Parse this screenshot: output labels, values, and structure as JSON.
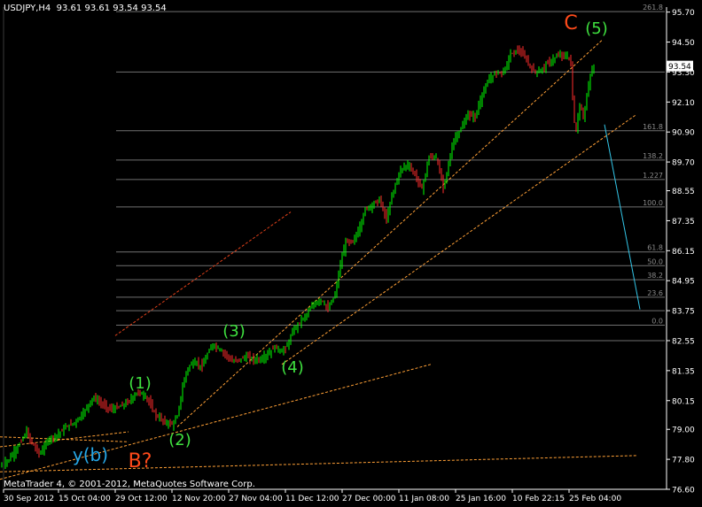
{
  "header": {
    "symbol": "USDJPY,H4",
    "ohlc": "93.61 93.61 93.54 93.54"
  },
  "footer": {
    "copyright": "MetaTrader 4, © 2001-2012, MetaQuotes Software Corp."
  },
  "price_badge": "93.54",
  "chart_data": {
    "type": "candlestick",
    "xlabel": "",
    "ylabel": "",
    "ylim": [
      76.6,
      95.9
    ],
    "y_ticks": [
      "95.70",
      "94.50",
      "93.30",
      "92.10",
      "90.90",
      "89.70",
      "88.55",
      "87.35",
      "86.15",
      "84.95",
      "83.75",
      "82.55",
      "81.35",
      "80.15",
      "79.00",
      "77.80",
      "76.60"
    ],
    "x_ticks": [
      "30 Sep 2012",
      "15 Oct 04:00",
      "29 Oct 12:00",
      "12 Nov 20:00",
      "27 Nov 04:00",
      "11 Dec 12:00",
      "27 Dec 00:00",
      "11 Jan 08:00",
      "25 Jan 16:00",
      "10 Feb 22:15",
      "25 Feb 04:00"
    ],
    "fib_levels": [
      {
        "label": "261.8",
        "price": 95.72
      },
      {
        "label": "161.8",
        "price": 90.95
      },
      {
        "label": "138.2",
        "price": 89.78
      },
      {
        "label": "1.227",
        "price": 89.0
      },
      {
        "label": "100.0",
        "price": 87.9
      },
      {
        "label": "61.8",
        "price": 86.1
      },
      {
        "label": "50.0",
        "price": 85.55
      },
      {
        "label": "38.2",
        "price": 84.99
      },
      {
        "label": "23.6",
        "price": 84.29
      },
      {
        "label": "0.0",
        "price": 83.17
      }
    ],
    "extra_levels": [
      93.3,
      83.75,
      82.55
    ],
    "price_path": [
      [
        0,
        77.5
      ],
      [
        10,
        77.8
      ],
      [
        20,
        78.3
      ],
      [
        30,
        78.9
      ],
      [
        35,
        78.5
      ],
      [
        45,
        78.0
      ],
      [
        55,
        78.6
      ],
      [
        65,
        78.8
      ],
      [
        75,
        79.1
      ],
      [
        85,
        79.3
      ],
      [
        95,
        79.7
      ],
      [
        105,
        80.3
      ],
      [
        115,
        80.0
      ],
      [
        125,
        79.8
      ],
      [
        135,
        79.9
      ],
      [
        145,
        80.1
      ],
      [
        155,
        80.5
      ],
      [
        165,
        80.3
      ],
      [
        175,
        79.6
      ],
      [
        185,
        79.3
      ],
      [
        195,
        79.2
      ],
      [
        200,
        79.5
      ],
      [
        205,
        80.5
      ],
      [
        210,
        81.3
      ],
      [
        215,
        81.6
      ],
      [
        220,
        81.7
      ],
      [
        228,
        81.5
      ],
      [
        234,
        82.0
      ],
      [
        240,
        82.4
      ],
      [
        248,
        82.2
      ],
      [
        255,
        82.0
      ],
      [
        262,
        81.7
      ],
      [
        270,
        81.8
      ],
      [
        278,
        81.9
      ],
      [
        286,
        81.8
      ],
      [
        294,
        81.8
      ],
      [
        302,
        82.0
      ],
      [
        310,
        82.3
      ],
      [
        318,
        82.1
      ],
      [
        325,
        82.4
      ],
      [
        330,
        82.9
      ],
      [
        338,
        83.3
      ],
      [
        346,
        83.6
      ],
      [
        354,
        84.0
      ],
      [
        362,
        84.2
      ],
      [
        370,
        83.8
      ],
      [
        378,
        84.4
      ],
      [
        384,
        85.6
      ],
      [
        390,
        86.5
      ],
      [
        398,
        86.5
      ],
      [
        405,
        87.0
      ],
      [
        412,
        87.8
      ],
      [
        420,
        88.0
      ],
      [
        428,
        88.2
      ],
      [
        436,
        87.4
      ],
      [
        444,
        88.6
      ],
      [
        452,
        89.4
      ],
      [
        460,
        89.6
      ],
      [
        468,
        89.2
      ],
      [
        476,
        88.6
      ],
      [
        484,
        89.9
      ],
      [
        492,
        89.9
      ],
      [
        500,
        88.7
      ],
      [
        506,
        89.6
      ],
      [
        512,
        90.6
      ],
      [
        520,
        91.0
      ],
      [
        528,
        91.6
      ],
      [
        536,
        91.5
      ],
      [
        544,
        92.4
      ],
      [
        552,
        93.0
      ],
      [
        560,
        93.3
      ],
      [
        568,
        93.3
      ],
      [
        576,
        94.0
      ],
      [
        584,
        94.2
      ],
      [
        592,
        93.9
      ],
      [
        600,
        93.4
      ],
      [
        608,
        93.3
      ],
      [
        616,
        93.6
      ],
      [
        624,
        93.8
      ],
      [
        632,
        94.0
      ],
      [
        640,
        93.9
      ],
      [
        644,
        93.7
      ],
      [
        647,
        91.5
      ],
      [
        650,
        90.9
      ],
      [
        654,
        92.0
      ],
      [
        658,
        91.5
      ],
      [
        662,
        92.3
      ],
      [
        666,
        93.2
      ],
      [
        670,
        93.5
      ]
    ],
    "annotations": [
      {
        "text": "(1)",
        "color": "#3fe03f"
      },
      {
        "text": "(2)",
        "color": "#3fe03f"
      },
      {
        "text": "(3)",
        "color": "#3fe03f"
      },
      {
        "text": "(4)",
        "color": "#3fe03f"
      },
      {
        "text": "(5)",
        "color": "#3fe03f"
      },
      {
        "text": "C",
        "color": "#ff4a1a"
      },
      {
        "text": "B?",
        "color": "#ff4a1a"
      },
      {
        "text": "y(b)",
        "color": "#26a7e6"
      }
    ],
    "colors": {
      "up": "#00ff00",
      "down": "#ff2d2d",
      "axis": "#ffffff",
      "grid_line": "#707070",
      "trend": "#ffa036",
      "channel": "#e0401a",
      "projection": "#33c6e8"
    }
  }
}
